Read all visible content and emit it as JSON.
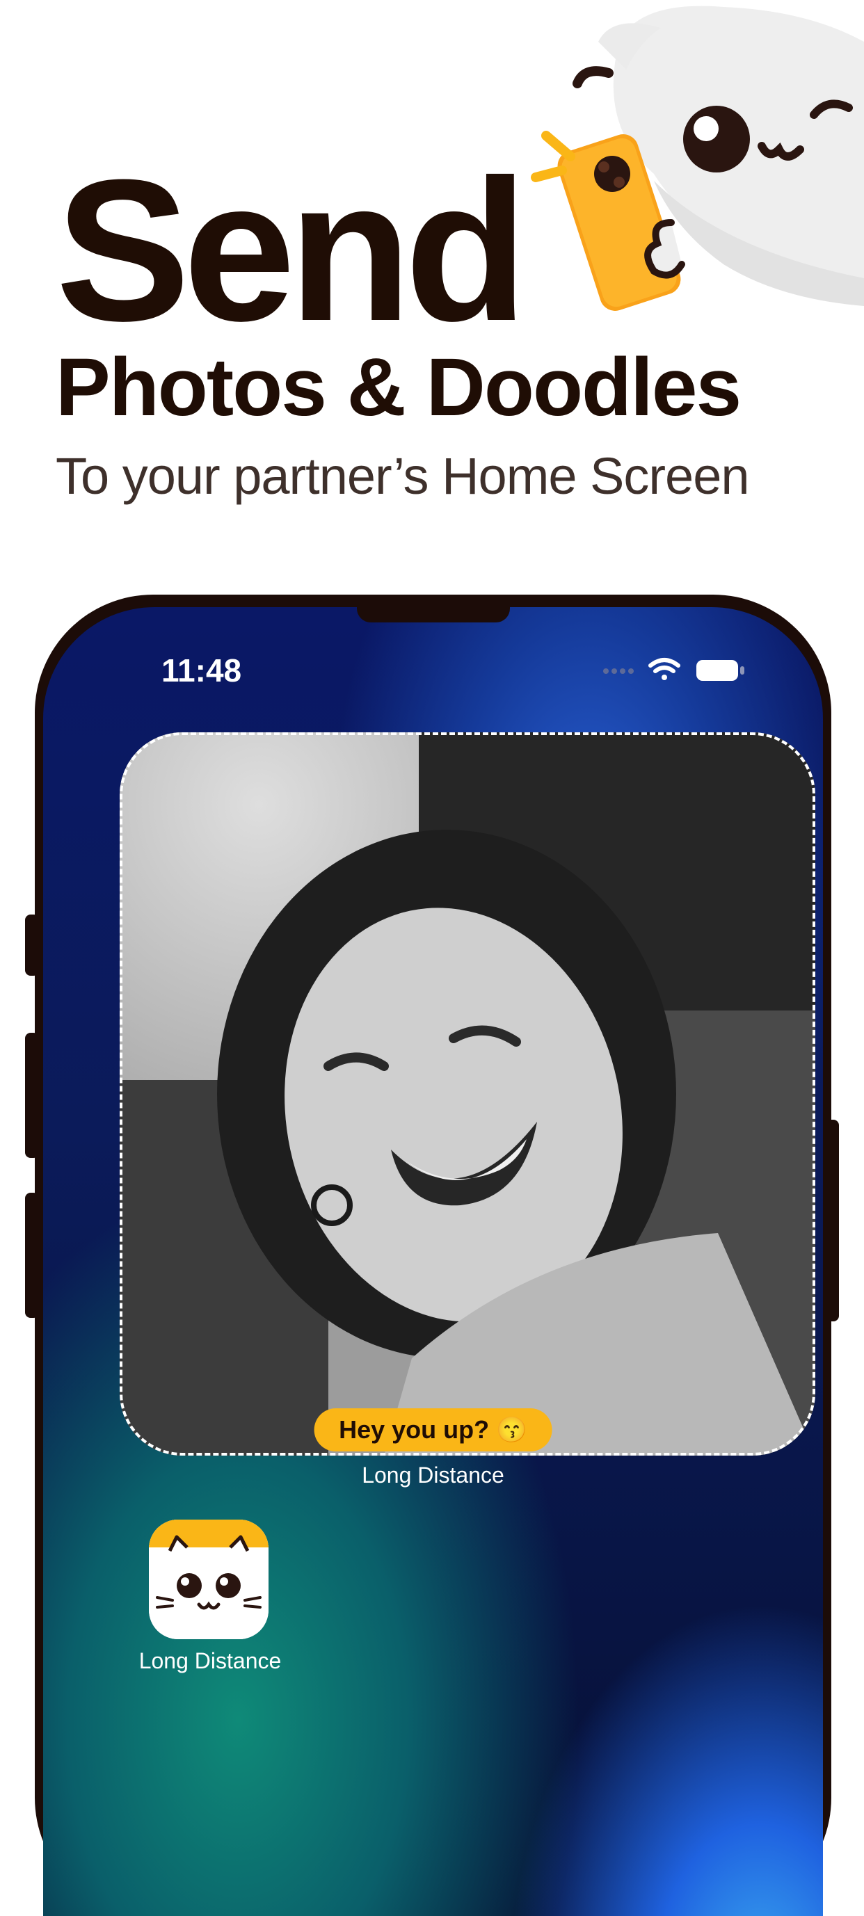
{
  "headline": {
    "line1": "Send",
    "line2": "Photos & Doodles",
    "line3": "To your partner’s Home Screen"
  },
  "status_bar": {
    "time": "11:48"
  },
  "widget": {
    "message": "Hey you up? 😙",
    "label": "Long Distance"
  },
  "app": {
    "label": "Long Distance"
  },
  "colors": {
    "text_dark": "#1f0d05",
    "accent_yellow": "#fab617",
    "phone_frame": "#1c0c08"
  }
}
